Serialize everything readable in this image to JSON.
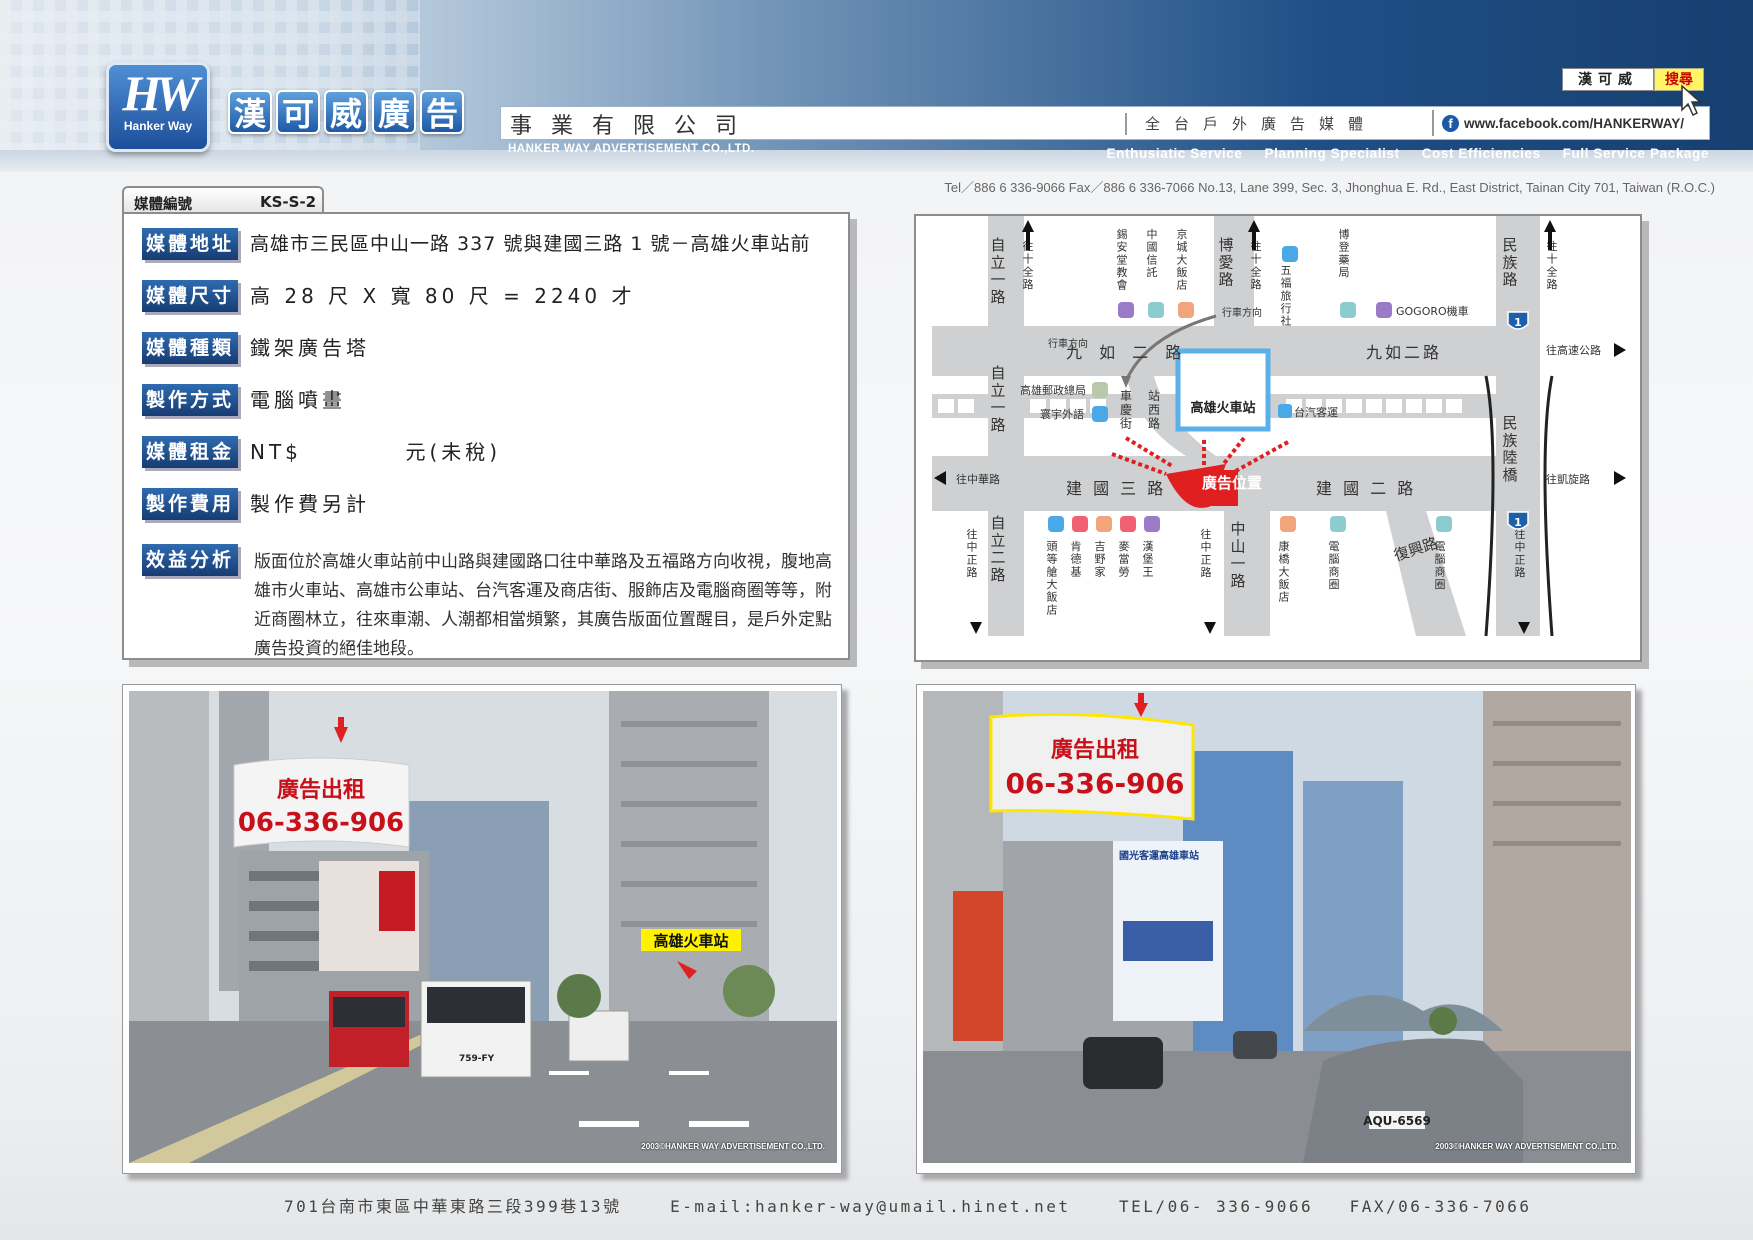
{
  "header": {
    "logo_mark": "HW",
    "logo_sub": "Hanker Way",
    "brand_chars": [
      "漢",
      "可",
      "威",
      "廣",
      "告"
    ],
    "company": "事業有限公司",
    "company_en": "HANKER WAY ADVERTISEMENT CO.,LTD.",
    "tagline": "全台戶外廣告媒體",
    "facebook_url": "www.facebook.com/HANKERWAY/",
    "search_label": "漢可威",
    "search_button": "搜尋",
    "services": [
      "Enthusiatic Service",
      "Planning Specialist",
      "Cost Efficiencies",
      "Full Service Package"
    ],
    "contact_line": "Tel／886 6 336-9066   Fax／886 6 336-7066   No.13, Lane 399, Sec. 3, Jhonghua E. Rd., East District, Tainan City 701, Taiwan (R.O.C.)"
  },
  "media_tag": {
    "label": "媒體編號",
    "code": "KS-S-2"
  },
  "info": {
    "rows": [
      {
        "label": "媒體地址",
        "value": "高雄市三民區中山一路 337 號與建國三路 1 號－高雄火車站前"
      },
      {
        "label": "媒體尺寸",
        "value": "高 28 尺 X 寬 80 尺 = 2240 才"
      },
      {
        "label": "媒體種類",
        "value": "鐵架廣告塔"
      },
      {
        "label": "製作方式",
        "value": "電腦噴畫"
      },
      {
        "label": "媒體租金",
        "value": "NT$          元(未稅)"
      },
      {
        "label": "製作費用",
        "value": "製作費另計"
      }
    ],
    "analysis_label": "效益分析",
    "analysis_text": "版面位於高雄火車站前中山路與建國路口往中華路及五福路方向收視，腹地高雄市火車站、高雄市公車站、台汽客運及商店街、服飾店及電腦商圈等等，附近商圈林立，往來車潮、人潮都相當頻繁，其廣告版面位置醒目，是戶外定點廣告投資的絕佳地段。"
  },
  "map": {
    "station": "高雄火車站",
    "ad_label": "廣告位置",
    "roads": {
      "ziyi_1": "自立一路",
      "ziyi_2": "自立二路",
      "jiuru_2_left": "九 如 二 路",
      "jiuru_2_right": "九如二路",
      "jianguo_3": "建 國 三 路",
      "jianguo_2": "建 國 二 路",
      "boai": "博愛路",
      "zhongshan_1": "中山一路",
      "fuxing": "復興路",
      "minzu": "民族路",
      "minzu_bridge": "民族陸橋",
      "chezhan_w": "站西路",
      "chezhan_e": "車慶街"
    },
    "directions": {
      "to_shiquan_1": "往十全路",
      "to_shiquan_2": "往十全路",
      "to_shiquan_3": "往十全路",
      "to_zhonghua": "往中華路",
      "to_kaixuan": "往凱旋路",
      "to_highway": "往高速公路",
      "to_zhongzheng_1": "往中正路",
      "to_zhongzheng_2": "往中正路",
      "to_zhongzheng_3": "往中正路",
      "traffic_dir_1": "行車方向",
      "traffic_dir_2": "行車方向"
    },
    "landmarks_top": [
      "錫安堂教會",
      "中國信託",
      "京城大飯店",
      "五福旅行社",
      "博登藥局",
      "GOGORO機車"
    ],
    "landmarks_left": [
      "高雄郵政總局",
      "寰宇外語"
    ],
    "landmark_taiqi": "台汽客運",
    "landmarks_bottom": [
      "頭等艙大飯店",
      "肯德基",
      "吉野家",
      "麥當勞",
      "漢堡王",
      "康橋大飯店",
      "電腦商圈",
      "電腦商圈"
    ],
    "highway_badge": "1"
  },
  "photo_left": {
    "billboard_title": "廣告出租",
    "billboard_phone": "06-336-906",
    "station_label": "高雄火車站",
    "bus_number": "759-FY",
    "copyright": "2003©HANKER WAY ADVERTISEMENT CO.,LTD."
  },
  "photo_right": {
    "billboard_title": "廣告出租",
    "billboard_phone": "06-336-906",
    "sign_text": "國光客運高雄車站",
    "plate": "AQU-6569",
    "copyright": "2003©HANKER WAY ADVERTISEMENT CO.,LTD."
  },
  "footer": {
    "address": "701台南市東區中華東路三段399巷13號",
    "email": "E-mail:hanker-way@umail.hinet.net",
    "tel": "TEL/06- 336-9066",
    "fax": "FAX/06-336-7066"
  },
  "colors": {
    "label_bg": "#1f4f8a",
    "road": "#cfd0d2",
    "accent_red": "#e02020",
    "billboard_text": "#c8101a"
  }
}
